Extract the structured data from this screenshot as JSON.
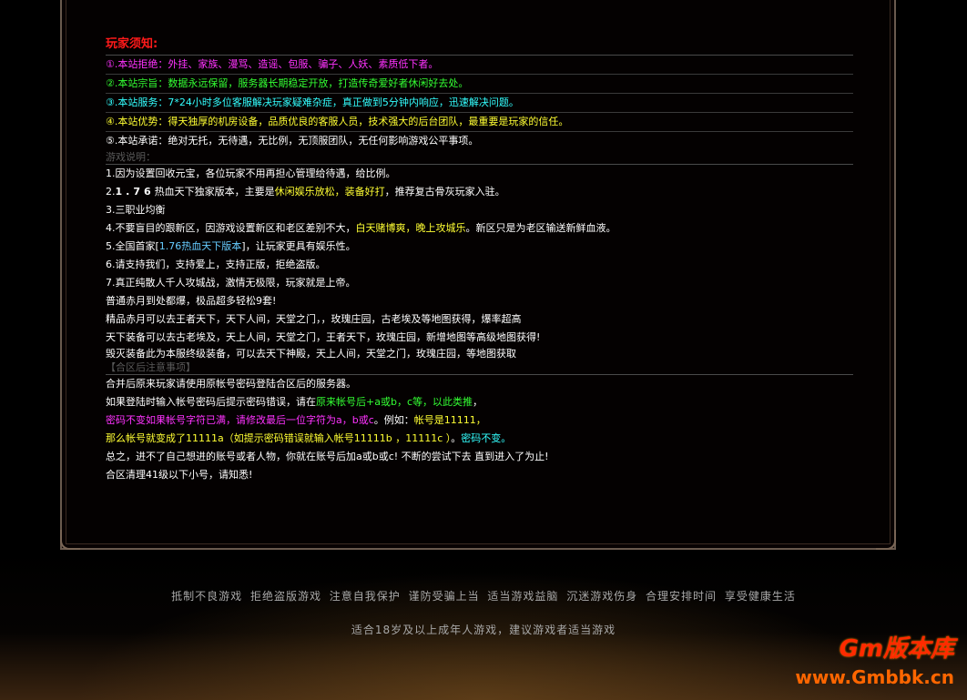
{
  "notice": {
    "title": "玩家须知:",
    "items": [
      "①.本站拒绝：外挂、家族、漫骂、造谣、包服、骗子、人妖、素质低下者。",
      "②.本站宗旨：数据永远保留，服务器长期稳定开放，打造传奇爱好者休闲好去处。",
      "③.本站服务：7*24小时多位客服解决玩家疑难杂症，真正做到5分钟内响应，迅速解决问题。",
      "④.本站优势：得天独厚的机房设备，品质优良的客服人员，技术强大的后台团队，最重要是玩家的信任。",
      "⑤.本站承诺：绝对无托，无待遇，无比例，无顶服团队，无任何影响游戏公平事项。"
    ]
  },
  "game_info": {
    "title": "游戏说明：",
    "lines": {
      "l1": "1.因为设置回收元宝，各位玩家不用再担心管理给待遇，给比例。",
      "l2a": "2.",
      "l2b": "1.76",
      "l2c": "热血天下独家版本，主要是",
      "l2d": "休闲娱乐放松，装备好打",
      "l2e": "，推荐复古骨灰玩家入驻。",
      "l3": "3.三职业均衡",
      "l4a": "4.不要盲目的跟新区，因游戏设置新区和老区差别不大，",
      "l4b": "白天赌博爽，晚上攻城乐",
      "l4c": "。新区只是为老区输送新鲜血液。",
      "l5a": "5.全国首家[",
      "l5b": "1.76热血天下版本",
      "l5c": "]，让玩家更具有娱乐性。",
      "l6": "6.请支持我们，支持爱上，支持正版，拒绝盗版。",
      "l7": "7.真正纯散人千人攻城战，激情无极限，玩家就是上帝。",
      "l8": "普通赤月到处都爆，极品超多轻松9套!",
      "l9": "精品赤月可以去王者天下，天下人间，天堂之门，，玫瑰庄园，古老埃及等地图获得，爆率超高",
      "l10": "天下装备可以去古老埃及，天上人间，天堂之门，王者天下，玫瑰庄园，新增地图等高级地图获得!",
      "l11": "毁灭装备此为本服终级装备，可以去天下神殿，天上人间，天堂之门，玫瑰庄园，等地图获取"
    }
  },
  "merge": {
    "title": "【合区后注意事项】",
    "lines": {
      "m1": "合并后原来玩家请使用原帐号密码登陆合区后的服务器。",
      "m2a": "如果登陆时输入帐号密码后提示密码错误，请在",
      "m2b": "原来帐号后+a或b，c等，以此类推",
      "m2c": "，",
      "m3a": "密码不变如果帐号字符已满，请修改最后一位字符为a，b或c",
      "m3b": "。例如：",
      "m3c": "帐号是11111，",
      "m4a": "那么帐号就变成了11111a（如提示密码错误就输入帐号11111b ，11111c ）",
      "m4b": "。",
      "m4c": "密码不变。",
      "m5": "总之，进不了自己想进的账号或者人物，你就在账号后加a或b或c! 不断的尝试下去 直到进入了为止!",
      "m6": "合区清理41级以下小号，请知悉!"
    }
  },
  "footer": {
    "links": "抵制不良游戏 拒绝盗版游戏 注意自我保护 谨防受骗上当 适当游戏益脑 沉迷游戏伤身 合理安排时间 享受健康生活",
    "age_note": "适合18岁及以上成年人游戏，建议游戏者适当游戏"
  },
  "watermark": {
    "brand": "Gm版本库",
    "url": "www.Gmbbk.cn"
  },
  "colors": {
    "title_red": "#ff1a1a",
    "magenta": "#ff33ff",
    "green": "#33ff33",
    "cyan": "#33ffff",
    "yellow": "#ffff33"
  }
}
